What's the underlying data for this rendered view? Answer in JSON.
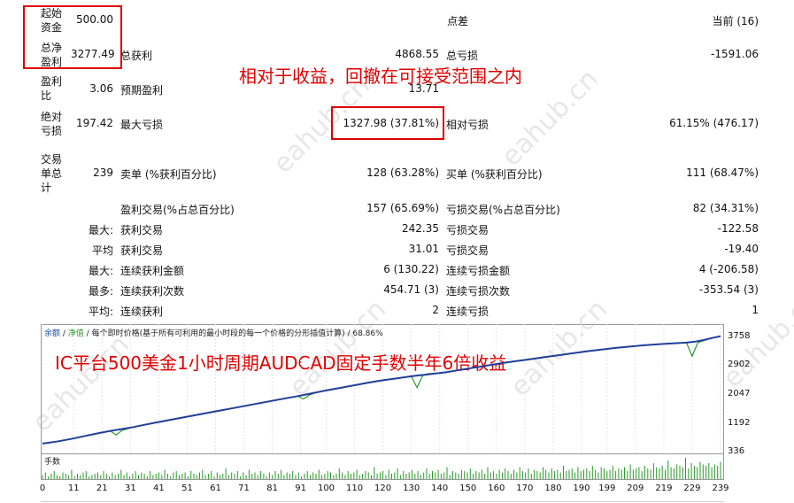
{
  "stats": {
    "initial_deposit_label": "起始\n资金",
    "initial_deposit_value": "500.00",
    "spread_label": "点差",
    "spread_value": "当前 (16)",
    "total_net_profit_label": "总净\n盈利",
    "total_net_profit_value": "3277.49",
    "gross_profit_label": "总获利",
    "gross_profit_value": "4868.55",
    "gross_loss_label": "总亏损",
    "gross_loss_value": "-1591.06",
    "profit_factor_label": "盈利\n比",
    "profit_factor_value": "3.06",
    "expected_payoff_label": "预期盈利",
    "expected_payoff_value": "13.71",
    "abs_drawdown_label": "绝对\n亏损",
    "abs_drawdown_value": "197.42",
    "max_drawdown_label": "最大亏损",
    "max_drawdown_value": "1327.98 (37.81%)",
    "rel_drawdown_label": "相对亏损",
    "rel_drawdown_value": "61.15% (476.17)",
    "total_trades_label": "交易\n单总\n计",
    "total_trades_value": "239",
    "short_label": "卖单 (%获利百分比)",
    "short_value": "128 (63.28%)",
    "long_label": "买单 (%获利百分比)",
    "long_value": "111 (68.47%)",
    "profit_trades_label": "盈利交易(%占总百分比)",
    "profit_trades_value": "157 (65.69%)",
    "loss_trades_label": "亏损交易(%占总百分比)",
    "loss_trades_value": "82 (34.31%)",
    "largest_prefix": "最大:",
    "largest_profit_label": "获利交易",
    "largest_profit_value": "242.35",
    "largest_loss_label": "亏损交易",
    "largest_loss_value": "-122.58",
    "average_prefix": "平均",
    "avg_profit_label": "获利交易",
    "avg_profit_value": "31.01",
    "avg_loss_label": "亏损交易",
    "avg_loss_value": "-19.40",
    "max_consec_prefix": "最大:",
    "max_consec_wins_label": "连续获利金额",
    "max_consec_wins_value": "6 (130.22)",
    "max_consec_losses_label": "连续亏损金额",
    "max_consec_losses_value": "4 (-206.58)",
    "maximal_prefix": "最多:",
    "max_consec_profit_label": "连续获利次数",
    "max_consec_profit_value": "454.71 (3)",
    "max_consec_loss_label": "连续亏损次数",
    "max_consec_loss_value": "-353.54 (3)",
    "avg_consec_prefix": "平均:",
    "avg_consec_wins_label": "连续获利",
    "avg_consec_wins_value": "2",
    "avg_consec_losses_label": "连续亏损",
    "avg_consec_losses_value": "1"
  },
  "annotations": {
    "top": "相对于收益，回撤在可接受范围之内",
    "chart": "IC平台500美金1小时周期AUDCAD固定手数半年6倍收益"
  },
  "watermark_text": "eahub.cn",
  "colors": {
    "accent_red": "#e00000",
    "balance_line": "#1f3f99",
    "equity_line": "#2a9a2a",
    "volume_bars": "#2a9a2a"
  },
  "chart_data": {
    "type": "line",
    "legend": {
      "balance": "余额",
      "sep1": " / ",
      "equity": "净值",
      "sep2": " / ",
      "model": "每个即时价格(基于所有可利用的最小时段的每一个价格的分形插值计算)",
      "sep3": " / ",
      "quality": "68.86%"
    },
    "ylim": [
      336,
      3800
    ],
    "yticks": [
      "3758",
      "2902",
      "2047",
      "1192",
      "336"
    ],
    "xticks": [
      "0",
      "11",
      "21",
      "31",
      "41",
      "51",
      "61",
      "71",
      "81",
      "91",
      "100",
      "110",
      "120",
      "130",
      "140",
      "150",
      "160",
      "170",
      "180",
      "190",
      "199",
      "209",
      "219",
      "229",
      "239"
    ],
    "volume_label": "手数",
    "series": [
      {
        "key": "balance",
        "x": [
          0,
          5,
          10,
          15,
          20,
          25,
          28,
          32,
          36,
          40,
          45,
          50,
          55,
          60,
          65,
          70,
          75,
          80,
          85,
          90,
          93,
          97,
          100,
          105,
          110,
          115,
          120,
          125,
          130,
          133,
          135,
          138,
          142,
          147,
          152,
          157,
          162,
          167,
          172,
          177,
          182,
          187,
          192,
          197,
          202,
          207,
          212,
          217,
          222,
          227,
          230,
          233,
          236,
          239
        ],
        "y": [
          500,
          560,
          640,
          730,
          820,
          900,
          940,
          1000,
          1070,
          1140,
          1220,
          1300,
          1380,
          1460,
          1540,
          1620,
          1700,
          1780,
          1860,
          1940,
          1990,
          2060,
          2110,
          2190,
          2270,
          2350,
          2420,
          2480,
          2540,
          2570,
          2590,
          2620,
          2660,
          2730,
          2800,
          2870,
          2940,
          3000,
          3060,
          3120,
          3180,
          3240,
          3300,
          3350,
          3400,
          3440,
          3480,
          3510,
          3540,
          3560,
          3590,
          3640,
          3700,
          3758
        ]
      },
      {
        "key": "equity",
        "x": [
          0,
          5,
          10,
          15,
          20,
          24,
          26,
          28,
          32,
          36,
          40,
          45,
          50,
          55,
          60,
          65,
          70,
          75,
          80,
          85,
          90,
          92,
          94,
          97,
          100,
          105,
          110,
          115,
          120,
          125,
          130,
          132,
          134,
          136,
          138,
          142,
          147,
          152,
          157,
          162,
          167,
          172,
          177,
          182,
          187,
          192,
          197,
          202,
          207,
          212,
          217,
          222,
          227,
          229,
          231,
          233,
          236,
          239
        ],
        "y": [
          500,
          560,
          640,
          730,
          820,
          880,
          760,
          900,
          1000,
          1070,
          1140,
          1220,
          1300,
          1380,
          1460,
          1540,
          1620,
          1700,
          1780,
          1860,
          1940,
          1850,
          1970,
          2060,
          2110,
          2190,
          2270,
          2350,
          2420,
          2480,
          2540,
          2200,
          2560,
          2620,
          2620,
          2660,
          2730,
          2800,
          2870,
          2940,
          3000,
          3060,
          3120,
          3180,
          3240,
          3300,
          3350,
          3400,
          3440,
          3480,
          3510,
          3540,
          3560,
          3150,
          3560,
          3620,
          3700,
          3758
        ]
      }
    ],
    "volume": [
      3,
      5,
      2,
      4,
      6,
      3,
      2,
      5,
      4,
      3,
      7,
      2,
      4,
      3,
      5,
      6,
      2,
      3,
      4,
      5,
      3,
      6,
      4,
      2,
      5,
      3,
      4,
      7,
      3,
      5,
      2,
      4,
      6,
      3,
      5,
      4,
      2,
      6,
      3,
      4,
      5,
      3,
      7,
      4,
      2,
      5,
      6,
      3,
      4,
      5,
      2,
      6,
      4,
      3,
      5,
      7,
      3,
      4,
      6,
      2,
      5,
      3,
      4,
      8,
      3,
      5,
      4,
      6,
      2,
      5,
      3,
      7,
      4,
      5,
      3,
      6,
      4,
      2,
      5,
      3,
      6,
      4,
      7,
      3,
      5,
      4,
      6,
      3,
      5,
      2,
      4,
      6,
      3,
      5,
      4,
      7,
      3,
      4,
      6,
      5,
      3,
      4,
      8,
      5,
      3,
      6,
      4,
      5,
      7,
      3,
      4,
      6,
      5,
      3,
      9,
      4,
      5,
      6,
      3,
      7,
      4,
      5,
      8,
      3,
      6,
      4,
      5,
      7,
      4,
      6,
      3,
      5,
      8,
      4,
      6,
      5,
      7,
      4,
      5,
      9,
      3,
      6,
      5,
      4,
      7,
      6,
      5,
      8,
      4,
      6,
      5,
      7,
      4,
      9,
      5,
      6,
      4,
      7,
      5,
      8,
      6,
      4,
      7,
      5,
      9,
      6,
      5,
      8,
      4,
      7,
      6,
      5,
      9,
      7,
      5,
      8,
      6,
      7,
      5,
      10,
      6,
      7,
      8,
      5,
      9,
      6,
      7,
      8,
      6,
      10,
      7,
      5,
      9,
      8,
      6,
      7,
      10,
      6,
      8,
      7,
      9,
      6,
      11,
      7,
      8,
      9,
      6,
      10,
      8,
      7,
      12,
      9,
      8,
      10,
      7,
      14,
      9,
      8,
      11,
      10,
      9,
      16,
      8,
      12,
      10,
      9,
      13,
      11,
      10,
      12,
      9,
      11,
      10,
      13
    ]
  }
}
